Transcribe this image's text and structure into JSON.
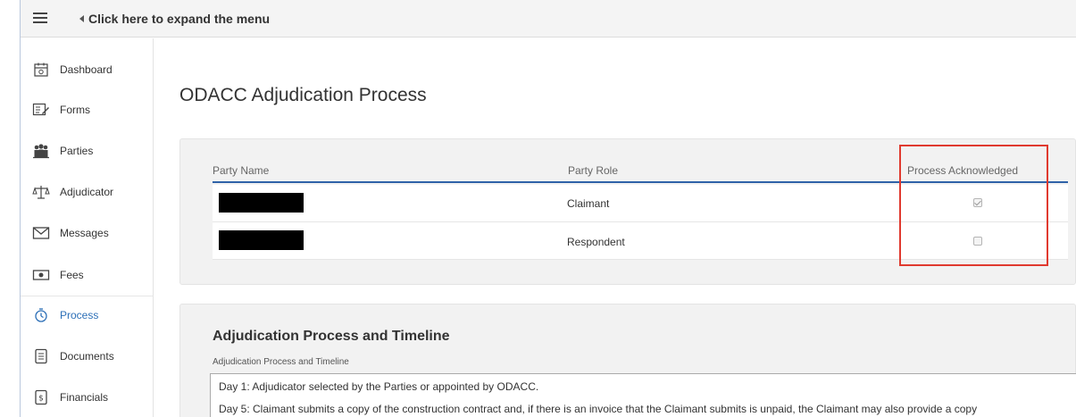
{
  "topbar": {
    "expand_label": "Click here to expand the menu"
  },
  "sidebar": {
    "items": [
      {
        "label": "Dashboard",
        "icon": "calendar-icon"
      },
      {
        "label": "Forms",
        "icon": "forms-icon"
      },
      {
        "label": "Parties",
        "icon": "people-icon"
      },
      {
        "label": "Adjudicator",
        "icon": "scales-icon"
      },
      {
        "label": "Messages",
        "icon": "envelope-icon"
      },
      {
        "label": "Fees",
        "icon": "money-icon"
      },
      {
        "label": "Process",
        "icon": "stopwatch-icon",
        "active": true
      },
      {
        "label": "Documents",
        "icon": "document-icon"
      },
      {
        "label": "Financials",
        "icon": "dollar-document-icon"
      }
    ]
  },
  "main": {
    "title": "ODACC Adjudication Process",
    "table": {
      "headers": [
        "Party Name",
        "Party Role",
        "Process Acknowledged"
      ],
      "rows": [
        {
          "name": "",
          "role": "Claimant",
          "acknowledged": true
        },
        {
          "name": "",
          "role": "Respondent",
          "acknowledged": false
        }
      ]
    },
    "timeline": {
      "title": "Adjudication Process and Timeline",
      "subtitle": "Adjudication Process and Timeline",
      "lines": [
        "Day 1: Adjudicator selected by the Parties or appointed by ODACC.",
        "Day 5: Claimant submits a copy of the construction contract and, if there is an invoice that the Claimant submits is unpaid, the Claimant may also provide a copy"
      ]
    }
  },
  "colors": {
    "accent": "#2f62a8",
    "highlight": "#e03a2f",
    "active_nav": "#2c6fb7"
  }
}
